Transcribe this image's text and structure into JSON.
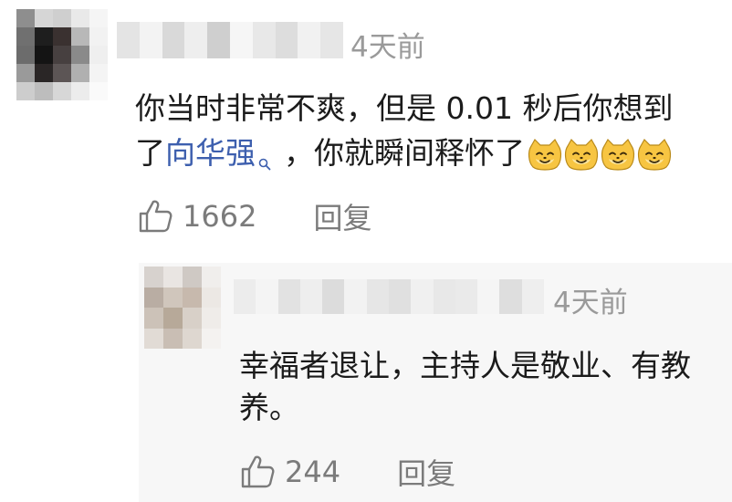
{
  "main_comment": {
    "time": "4天前",
    "text_line1": "你当时非常不爽，但是 0.01 秒后你想到",
    "text_line2_prefix": "了",
    "link_text": "向华强",
    "text_line2_suffix": "，你就瞬间释怀了",
    "emoji_icon": "cat-face-emoji",
    "emoji_count": 4,
    "like_count": "1662",
    "reply_label": "回复"
  },
  "reply_comment": {
    "time": "4天前",
    "text_line1": "幸福者退让，主持人是敬业、有教",
    "text_line2": "养。",
    "like_count": "244",
    "reply_label": "回复"
  },
  "colors": {
    "link": "#3d5fae",
    "muted": "#9a9a9a",
    "action_gray": "#7b7b7b",
    "reply_background": "#f7f7f7"
  }
}
